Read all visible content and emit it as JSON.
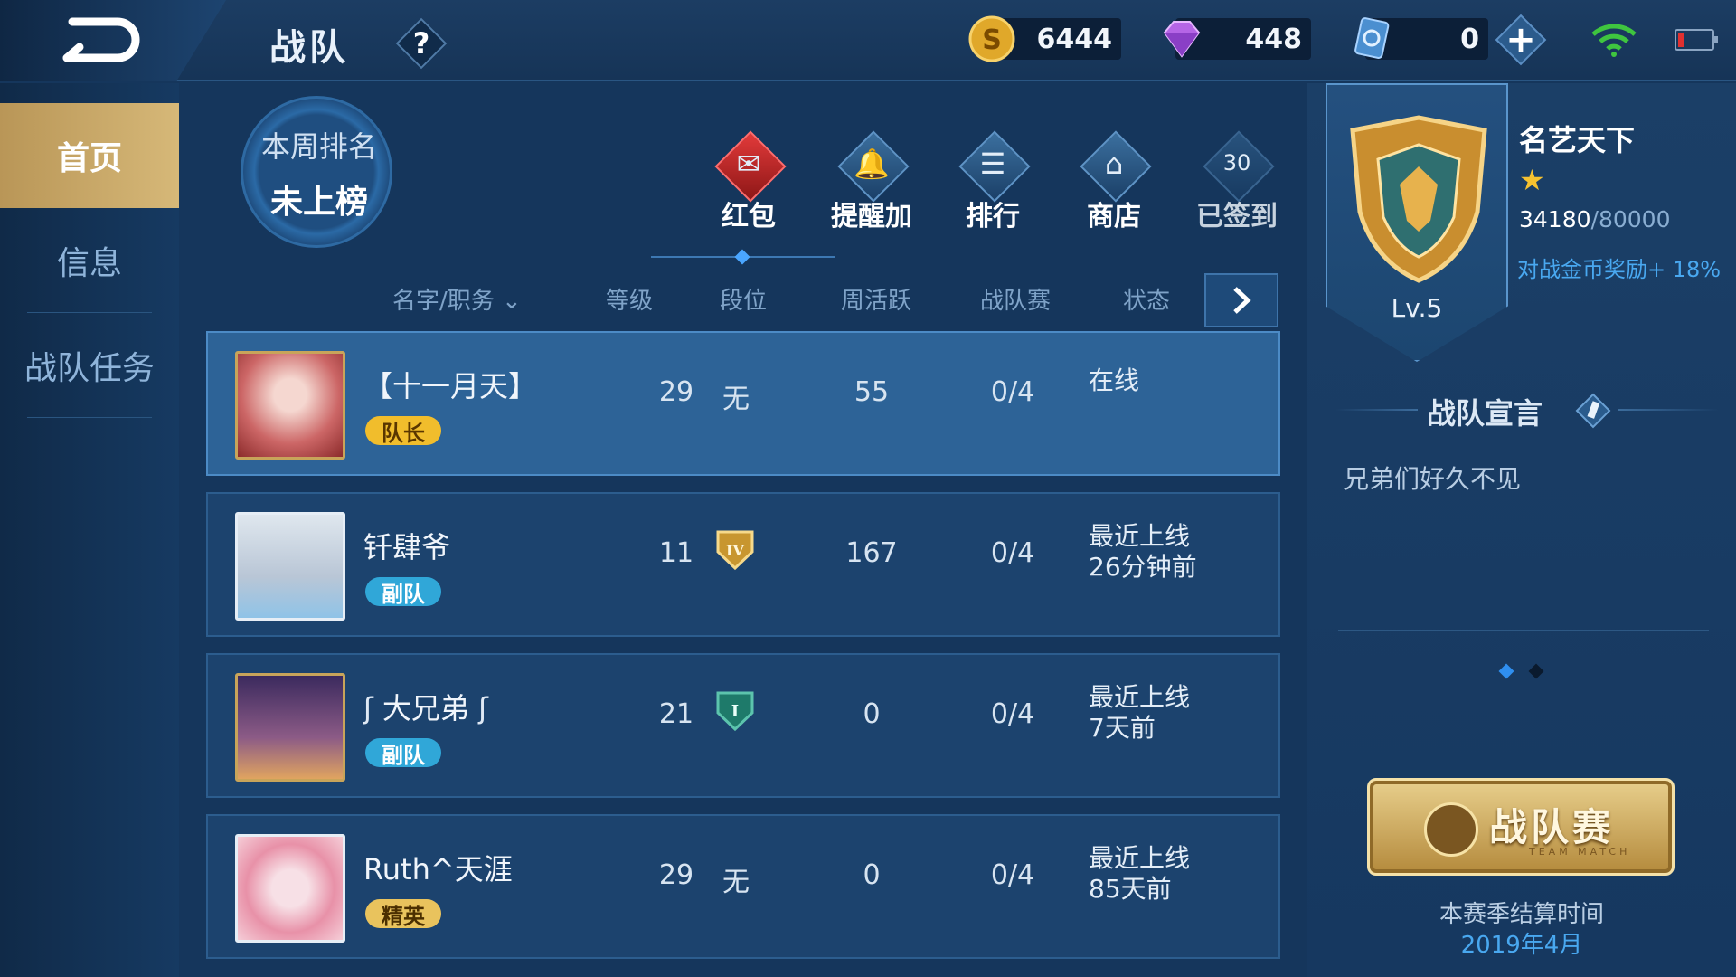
{
  "header": {
    "title": "战队",
    "help_glyph": "?",
    "gold": "6444",
    "gems": "448",
    "vouchers": "0",
    "plus_glyph": "+"
  },
  "sidebar": {
    "items": [
      {
        "label": "首页",
        "active": true
      },
      {
        "label": "信息",
        "active": false
      },
      {
        "label": "战队任务",
        "active": false
      }
    ]
  },
  "weekly_rank": {
    "label": "本周排名",
    "value": "未上榜"
  },
  "actions": [
    {
      "label": "红包",
      "icon": "red-envelope-icon"
    },
    {
      "label": "提醒加",
      "icon": "bell-link-icon"
    },
    {
      "label": "排行",
      "icon": "ranking-icon"
    },
    {
      "label": "商店",
      "icon": "shop-icon"
    },
    {
      "label": "已签到",
      "icon": "calendar-30-icon"
    }
  ],
  "table": {
    "headers": [
      "名字/职务",
      "等级",
      "段位",
      "周活跃",
      "战队赛",
      "状态"
    ],
    "sort_glyph": "⌄",
    "rows": [
      {
        "name": "【十一月天】",
        "role": "队长",
        "level": "29",
        "rank": "无",
        "rank_icon": "",
        "weekly": "55",
        "match": "0/4",
        "status": "在线"
      },
      {
        "name": "钎肆爷",
        "role": "副队",
        "level": "11",
        "rank": "",
        "rank_icon": "IV",
        "weekly": "167",
        "match": "0/4",
        "status": "最近上线\n26分钟前"
      },
      {
        "name": "大兄弟",
        "role": "副队",
        "level": "21",
        "rank": "",
        "rank_icon": "I",
        "weekly": "0",
        "match": "0/4",
        "status": "最近上线\n7天前"
      },
      {
        "name": "Ruth^天涯",
        "role": "精英",
        "level": "29",
        "rank": "无",
        "rank_icon": "",
        "weekly": "0",
        "match": "0/4",
        "status": "最近上线\n85天前"
      }
    ]
  },
  "team": {
    "name": "名艺天下",
    "level": "Lv.5",
    "exp": "34180",
    "exp_max": "/80000",
    "bonus": "对战金币奖励+ 18%",
    "declaration_title": "战队宣言",
    "declaration": "兄弟们好久不见",
    "star_glyph": "★"
  },
  "match": {
    "label": "战队赛",
    "sub": "TEAM MATCH",
    "season_label": "本赛季结算时间",
    "season_date": "2019年4月"
  },
  "colors": {
    "background": "#15365c",
    "accent_blue": "#49a8f0",
    "active_tab": "#d6b878",
    "captain_badge": "#f1bd2c",
    "vice_badge": "#30a7d8"
  }
}
